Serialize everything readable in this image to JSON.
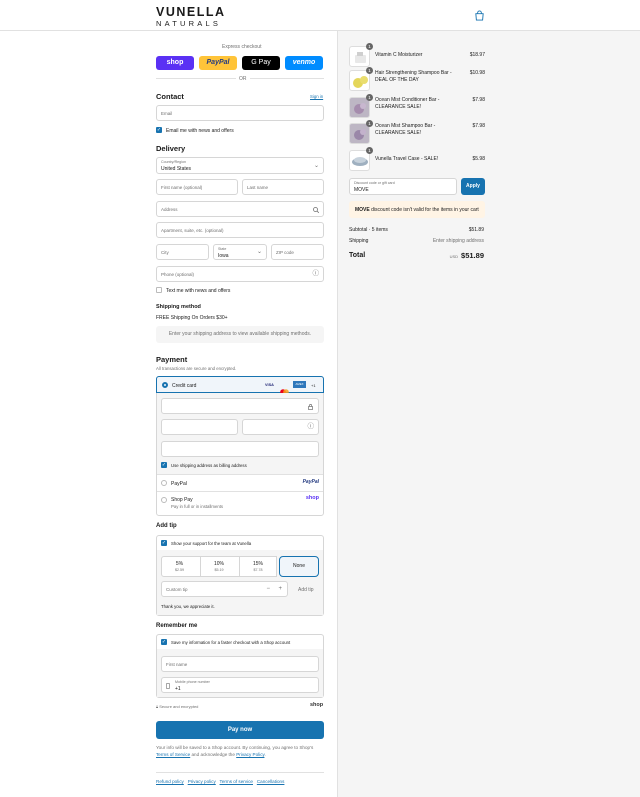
{
  "brand": {
    "line1": "VUNELLA",
    "line2": "NATURALS"
  },
  "express": {
    "title": "Express checkout",
    "or": "OR",
    "buttons": [
      {
        "label": "shop",
        "color": "#5a31f4"
      },
      {
        "label": "PayPal",
        "color": "#ffc439"
      },
      {
        "label": "G Pay",
        "color": "#000000"
      },
      {
        "label": "venmo",
        "color": "#008cff"
      }
    ]
  },
  "contact": {
    "title": "Contact",
    "signin": "Sign in",
    "email_placeholder": "Email",
    "news_label": "Email me with news and offers"
  },
  "delivery": {
    "title": "Delivery",
    "country_label": "Country/Region",
    "country_value": "United States",
    "first_name": "First name (optional)",
    "last_name": "Last name",
    "address": "Address",
    "apartment": "Apartment, suite, etc. (optional)",
    "city": "City",
    "state_label": "State",
    "state_value": "Iowa",
    "zip": "ZIP code",
    "phone": "Phone (optional)",
    "text_label": "Text me with news and offers"
  },
  "shipping": {
    "title": "Shipping method",
    "free_note": "FREE Shipping On Orders $30+",
    "placeholder": "Enter your shipping address to view available shipping methods."
  },
  "payment": {
    "title": "Payment",
    "subtitle": "All transactions are secure and encrypted.",
    "credit_label": "Credit card",
    "cards": [
      "VISA",
      "MC",
      "AMEX",
      "+1"
    ],
    "billing_label": "Use shipping address as billing address",
    "paypal": "PayPal",
    "paypal_logo": "PayPal",
    "shoppay": "Shop Pay",
    "shoppay_sub": "Pay in full or in installments",
    "shoppay_logo": "shop"
  },
  "tip": {
    "title": "Add tip",
    "support": "Show your support for the team at Vunella",
    "options": [
      {
        "pct": "5%",
        "amt": "$2.59"
      },
      {
        "pct": "10%",
        "amt": "$5.19"
      },
      {
        "pct": "15%",
        "amt": "$7.78"
      },
      {
        "pct": "None",
        "amt": ""
      }
    ],
    "custom": "Custom tip",
    "minus": "−",
    "plus": "+",
    "add": "Add tip",
    "thanks": "Thank you, we appreciate it."
  },
  "remember": {
    "title": "Remember me",
    "save": "Save my information for a faster checkout with a Shop account",
    "first_name": "First name",
    "mobile_label": "Mobile phone number",
    "mobile_value": "+1",
    "secure": "Secure and encrypted",
    "shop": "shop"
  },
  "pay": {
    "label": "Pay now",
    "legal1": "Your info will be saved to a Shop account. By continuing, you agree to Shop's",
    "tos": "Terms of Service",
    "and": "and acknowledge the",
    "privacy": "Privacy Policy"
  },
  "footer": {
    "links": [
      "Refund policy",
      "Privacy policy",
      "Terms of service",
      "Cancellations"
    ]
  },
  "summary": {
    "items": [
      {
        "qty": "1",
        "name": "Vitamin C Moisturizer",
        "price": "$18.97"
      },
      {
        "qty": "1",
        "name": "Hair Strengthening Shampoo Bar - DEAL OF THE DAY",
        "price": "$10.98"
      },
      {
        "qty": "1",
        "name": "Ocean Mist Conditioner Bar - CLEARANCE SALE!",
        "price": "$7.98"
      },
      {
        "qty": "1",
        "name": "Ocean Mist Shampoo Bar - CLEARANCE SALE!",
        "price": "$7.98"
      },
      {
        "qty": "1",
        "name": "Vunella Travel Case - SALE!",
        "price": "$5.98"
      }
    ],
    "discount_label": "Discount code or gift card",
    "discount_value": "MOVE",
    "apply": "Apply",
    "warn_code": "MOVE",
    "warn_text": "discount code isn't valid for the items in your cart",
    "subtotal_label": "Subtotal · 5 items",
    "subtotal": "$51.89",
    "shipping_label": "Shipping",
    "shipping_value": "Enter shipping address",
    "total_label": "Total",
    "currency": "USD",
    "total": "$51.89"
  },
  "colors": {
    "accent": "#1773b0",
    "pay": "#1773b0"
  }
}
